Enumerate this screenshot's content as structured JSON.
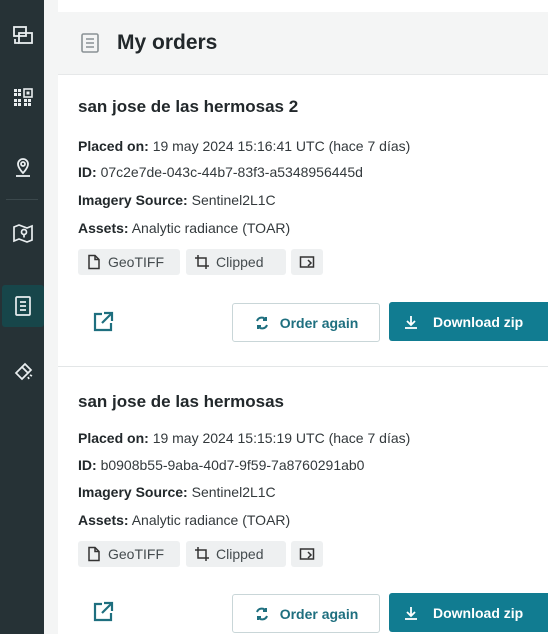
{
  "sidebar": {
    "items": [
      {
        "icon": "layers-icon"
      },
      {
        "icon": "qr-grid-icon"
      },
      {
        "icon": "location-pin-icon"
      },
      {
        "icon": "map-pin-icon"
      },
      {
        "icon": "orders-list-icon",
        "active": true
      },
      {
        "icon": "satellite-icon"
      }
    ]
  },
  "header": {
    "icon": "receipt-icon",
    "title": "My orders"
  },
  "orders": [
    {
      "title": "san jose de las hermosas 2",
      "placed_label": "Placed on:",
      "placed_value": "19 may 2024 15:16:41 UTC (hace 7 días)",
      "id_label": "ID:",
      "id_value": "07c2e7de-043c-44b7-83f3-a5348956445d",
      "source_label": "Imagery Source:",
      "source_value": "Sentinel2L1C",
      "assets_label": "Assets:",
      "assets_value": "Analytic radiance (TOAR)",
      "chips": [
        "GeoTIFF",
        "Clipped"
      ],
      "order_again": "Order again",
      "download": "Download zip"
    },
    {
      "title": "san jose de las hermosas",
      "placed_label": "Placed on:",
      "placed_value": "19 may 2024 15:15:19 UTC (hace 7 días)",
      "id_label": "ID:",
      "id_value": "b0908b55-9aba-40d7-9f59-7a8760291ab0",
      "source_label": "Imagery Source:",
      "source_value": "Sentinel2L1C",
      "assets_label": "Assets:",
      "assets_value": "Analytic radiance (TOAR)",
      "chips": [
        "GeoTIFF",
        "Clipped"
      ],
      "order_again": "Order again",
      "download": "Download zip"
    }
  ],
  "colors": {
    "sidebar": "#263236",
    "active": "#17464a",
    "primary": "#117c91",
    "accent_text": "#1e6f7f"
  }
}
